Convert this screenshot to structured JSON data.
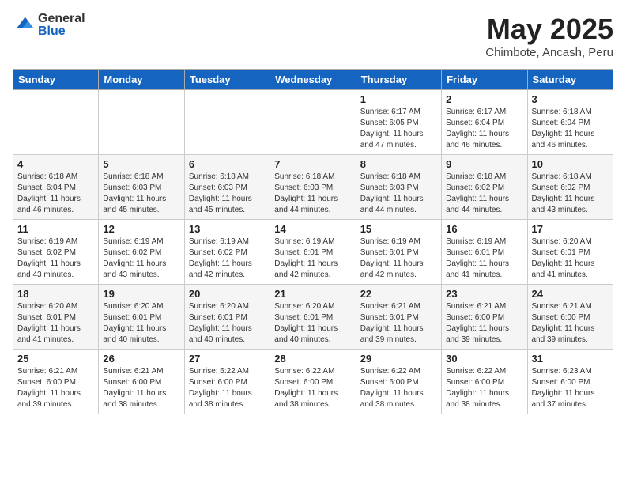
{
  "header": {
    "logo_general": "General",
    "logo_blue": "Blue",
    "title": "May 2025",
    "subtitle": "Chimbote, Ancash, Peru"
  },
  "days_of_week": [
    "Sunday",
    "Monday",
    "Tuesday",
    "Wednesday",
    "Thursday",
    "Friday",
    "Saturday"
  ],
  "weeks": [
    [
      {
        "day": "",
        "info": ""
      },
      {
        "day": "",
        "info": ""
      },
      {
        "day": "",
        "info": ""
      },
      {
        "day": "",
        "info": ""
      },
      {
        "day": "1",
        "info": "Sunrise: 6:17 AM\nSunset: 6:05 PM\nDaylight: 11 hours\nand 47 minutes."
      },
      {
        "day": "2",
        "info": "Sunrise: 6:17 AM\nSunset: 6:04 PM\nDaylight: 11 hours\nand 46 minutes."
      },
      {
        "day": "3",
        "info": "Sunrise: 6:18 AM\nSunset: 6:04 PM\nDaylight: 11 hours\nand 46 minutes."
      }
    ],
    [
      {
        "day": "4",
        "info": "Sunrise: 6:18 AM\nSunset: 6:04 PM\nDaylight: 11 hours\nand 46 minutes."
      },
      {
        "day": "5",
        "info": "Sunrise: 6:18 AM\nSunset: 6:03 PM\nDaylight: 11 hours\nand 45 minutes."
      },
      {
        "day": "6",
        "info": "Sunrise: 6:18 AM\nSunset: 6:03 PM\nDaylight: 11 hours\nand 45 minutes."
      },
      {
        "day": "7",
        "info": "Sunrise: 6:18 AM\nSunset: 6:03 PM\nDaylight: 11 hours\nand 44 minutes."
      },
      {
        "day": "8",
        "info": "Sunrise: 6:18 AM\nSunset: 6:03 PM\nDaylight: 11 hours\nand 44 minutes."
      },
      {
        "day": "9",
        "info": "Sunrise: 6:18 AM\nSunset: 6:02 PM\nDaylight: 11 hours\nand 44 minutes."
      },
      {
        "day": "10",
        "info": "Sunrise: 6:18 AM\nSunset: 6:02 PM\nDaylight: 11 hours\nand 43 minutes."
      }
    ],
    [
      {
        "day": "11",
        "info": "Sunrise: 6:19 AM\nSunset: 6:02 PM\nDaylight: 11 hours\nand 43 minutes."
      },
      {
        "day": "12",
        "info": "Sunrise: 6:19 AM\nSunset: 6:02 PM\nDaylight: 11 hours\nand 43 minutes."
      },
      {
        "day": "13",
        "info": "Sunrise: 6:19 AM\nSunset: 6:02 PM\nDaylight: 11 hours\nand 42 minutes."
      },
      {
        "day": "14",
        "info": "Sunrise: 6:19 AM\nSunset: 6:01 PM\nDaylight: 11 hours\nand 42 minutes."
      },
      {
        "day": "15",
        "info": "Sunrise: 6:19 AM\nSunset: 6:01 PM\nDaylight: 11 hours\nand 42 minutes."
      },
      {
        "day": "16",
        "info": "Sunrise: 6:19 AM\nSunset: 6:01 PM\nDaylight: 11 hours\nand 41 minutes."
      },
      {
        "day": "17",
        "info": "Sunrise: 6:20 AM\nSunset: 6:01 PM\nDaylight: 11 hours\nand 41 minutes."
      }
    ],
    [
      {
        "day": "18",
        "info": "Sunrise: 6:20 AM\nSunset: 6:01 PM\nDaylight: 11 hours\nand 41 minutes."
      },
      {
        "day": "19",
        "info": "Sunrise: 6:20 AM\nSunset: 6:01 PM\nDaylight: 11 hours\nand 40 minutes."
      },
      {
        "day": "20",
        "info": "Sunrise: 6:20 AM\nSunset: 6:01 PM\nDaylight: 11 hours\nand 40 minutes."
      },
      {
        "day": "21",
        "info": "Sunrise: 6:20 AM\nSunset: 6:01 PM\nDaylight: 11 hours\nand 40 minutes."
      },
      {
        "day": "22",
        "info": "Sunrise: 6:21 AM\nSunset: 6:01 PM\nDaylight: 11 hours\nand 39 minutes."
      },
      {
        "day": "23",
        "info": "Sunrise: 6:21 AM\nSunset: 6:00 PM\nDaylight: 11 hours\nand 39 minutes."
      },
      {
        "day": "24",
        "info": "Sunrise: 6:21 AM\nSunset: 6:00 PM\nDaylight: 11 hours\nand 39 minutes."
      }
    ],
    [
      {
        "day": "25",
        "info": "Sunrise: 6:21 AM\nSunset: 6:00 PM\nDaylight: 11 hours\nand 39 minutes."
      },
      {
        "day": "26",
        "info": "Sunrise: 6:21 AM\nSunset: 6:00 PM\nDaylight: 11 hours\nand 38 minutes."
      },
      {
        "day": "27",
        "info": "Sunrise: 6:22 AM\nSunset: 6:00 PM\nDaylight: 11 hours\nand 38 minutes."
      },
      {
        "day": "28",
        "info": "Sunrise: 6:22 AM\nSunset: 6:00 PM\nDaylight: 11 hours\nand 38 minutes."
      },
      {
        "day": "29",
        "info": "Sunrise: 6:22 AM\nSunset: 6:00 PM\nDaylight: 11 hours\nand 38 minutes."
      },
      {
        "day": "30",
        "info": "Sunrise: 6:22 AM\nSunset: 6:00 PM\nDaylight: 11 hours\nand 38 minutes."
      },
      {
        "day": "31",
        "info": "Sunrise: 6:23 AM\nSunset: 6:00 PM\nDaylight: 11 hours\nand 37 minutes."
      }
    ]
  ]
}
